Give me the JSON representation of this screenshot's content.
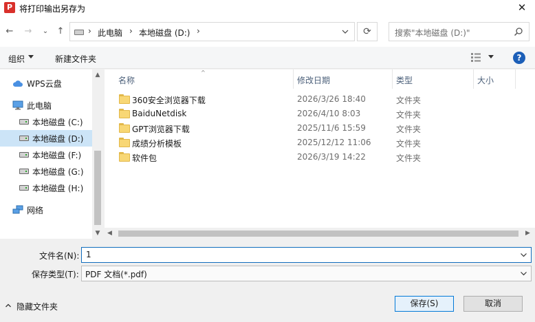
{
  "window": {
    "title": "将打印输出另存为",
    "app_icon": "P",
    "close_glyph": "✕"
  },
  "nav": {
    "back_icon": "←",
    "forward_icon": "→",
    "recent_icon": "⌄",
    "up_icon": "↑",
    "breadcrumb": [
      "此电脑",
      "本地磁盘 (D:)"
    ],
    "breadcrumb_sep": "›",
    "refresh_icon": "⟳",
    "search_placeholder": "搜索\"本地磁盘 (D:)\""
  },
  "toolbar": {
    "organize_label": "组织",
    "new_folder_label": "新建文件夹"
  },
  "sidebar": {
    "items": [
      {
        "label": "WPS云盘",
        "icon": "cloud-icon"
      },
      {
        "label": "此电脑",
        "icon": "pc-icon"
      },
      {
        "label": "本地磁盘 (C:)",
        "icon": "drive-icon"
      },
      {
        "label": "本地磁盘 (D:)",
        "icon": "drive-icon",
        "selected": true
      },
      {
        "label": "本地磁盘 (F:)",
        "icon": "drive-icon"
      },
      {
        "label": "本地磁盘 (G:)",
        "icon": "drive-icon"
      },
      {
        "label": "本地磁盘 (H:)",
        "icon": "drive-icon"
      },
      {
        "label": "网络",
        "icon": "network-icon"
      }
    ]
  },
  "files": {
    "columns": [
      "名称",
      "修改日期",
      "类型",
      "大小"
    ],
    "rows": [
      {
        "name": "360安全浏览器下载",
        "date": "2026/3/26 18:40",
        "type": "文件夹"
      },
      {
        "name": "BaiduNetdisk",
        "date": "2026/4/10 8:03",
        "type": "文件夹"
      },
      {
        "name": "GPT浏览器下载",
        "date": "2025/11/6 15:59",
        "type": "文件夹"
      },
      {
        "name": "成绩分析模板",
        "date": "2025/12/12 11:06",
        "type": "文件夹"
      },
      {
        "name": "软件包",
        "date": "2026/3/19 14:22",
        "type": "文件夹"
      }
    ]
  },
  "form": {
    "filename_label": "文件名(N):",
    "filename_value": "1",
    "filetype_label": "保存类型(T):",
    "filetype_value": "PDF 文档(*.pdf)"
  },
  "footer": {
    "hide_folders_label": "隐藏文件夹",
    "save_label": "保存(S)",
    "cancel_label": "取消"
  },
  "colors": {
    "accent": "#0078d7",
    "selection": "#cce4f7",
    "help_icon": "#1c5fb8",
    "app_icon": "#d9302b"
  }
}
